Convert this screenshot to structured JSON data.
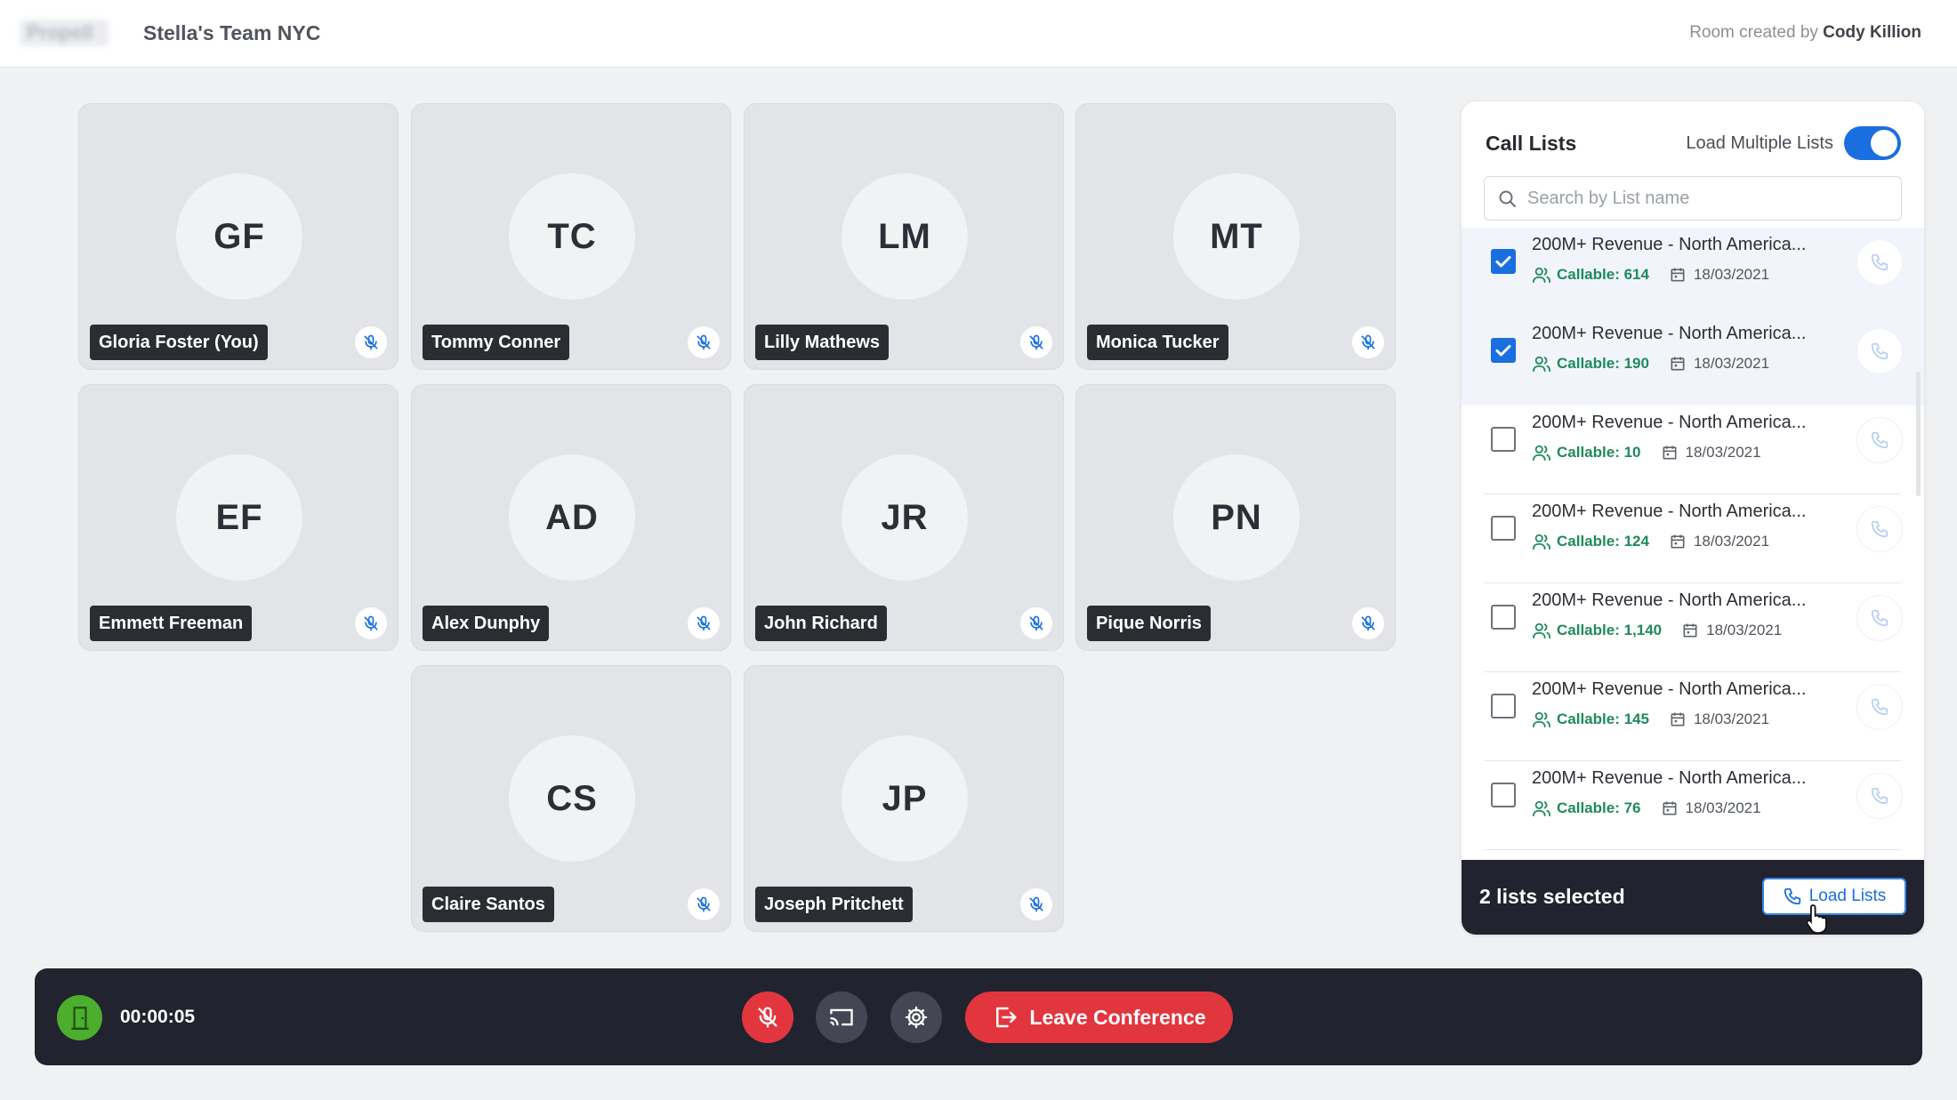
{
  "header": {
    "brand": "Propell",
    "room_name": "Stella's Team NYC",
    "room_created_prefix": "Room created by",
    "room_creator": "Cody Killion"
  },
  "participants": [
    {
      "initials": "GF",
      "name": "Gloria Foster (You)",
      "muted": true
    },
    {
      "initials": "TC",
      "name": "Tommy Conner",
      "muted": true
    },
    {
      "initials": "LM",
      "name": "Lilly Mathews",
      "muted": true
    },
    {
      "initials": "MT",
      "name": "Monica Tucker",
      "muted": true
    },
    {
      "initials": "EF",
      "name": "Emmett Freeman",
      "muted": true
    },
    {
      "initials": "AD",
      "name": "Alex Dunphy",
      "muted": true
    },
    {
      "initials": "JR",
      "name": "John Richard",
      "muted": true
    },
    {
      "initials": "PN",
      "name": "Pique Norris",
      "muted": true
    },
    {
      "initials": "CS",
      "name": "Claire Santos",
      "muted": true
    },
    {
      "initials": "JP",
      "name": "Joseph Pritchett",
      "muted": true
    }
  ],
  "call_lists": {
    "title": "Call Lists",
    "multi_label": "Load Multiple Lists",
    "multi_enabled": true,
    "search_placeholder": "Search by List name",
    "items": [
      {
        "name": "200M+ Revenue - North America...",
        "callable": "Callable: 614",
        "date": "18/03/2021",
        "checked": true
      },
      {
        "name": "200M+ Revenue - North America...",
        "callable": "Callable: 190",
        "date": "18/03/2021",
        "checked": true
      },
      {
        "name": "200M+ Revenue - North America...",
        "callable": "Callable: 10",
        "date": "18/03/2021",
        "checked": false
      },
      {
        "name": "200M+ Revenue - North America...",
        "callable": "Callable: 124",
        "date": "18/03/2021",
        "checked": false
      },
      {
        "name": "200M+ Revenue - North America...",
        "callable": "Callable: 1,140",
        "date": "18/03/2021",
        "checked": false
      },
      {
        "name": "200M+ Revenue - North America...",
        "callable": "Callable: 145",
        "date": "18/03/2021",
        "checked": false
      },
      {
        "name": "200M+ Revenue - North America...",
        "callable": "Callable: 76",
        "date": "18/03/2021",
        "checked": false
      }
    ],
    "selected_count": "2 lists selected",
    "load_button": "Load Lists"
  },
  "controls": {
    "timer": "00:00:05",
    "leave_label": "Leave Conference"
  },
  "colors": {
    "accent": "#1a6fe0",
    "danger": "#e2363f",
    "success": "#4cae2c",
    "callable": "#1f8a5c",
    "dark": "#21232f"
  },
  "icons": [
    "door-icon",
    "mic-off-icon",
    "screen-share-icon",
    "gear-icon",
    "leave-icon",
    "search-icon",
    "phone-icon",
    "users-icon",
    "calendar-icon",
    "check-icon",
    "pointer-cursor-icon"
  ]
}
